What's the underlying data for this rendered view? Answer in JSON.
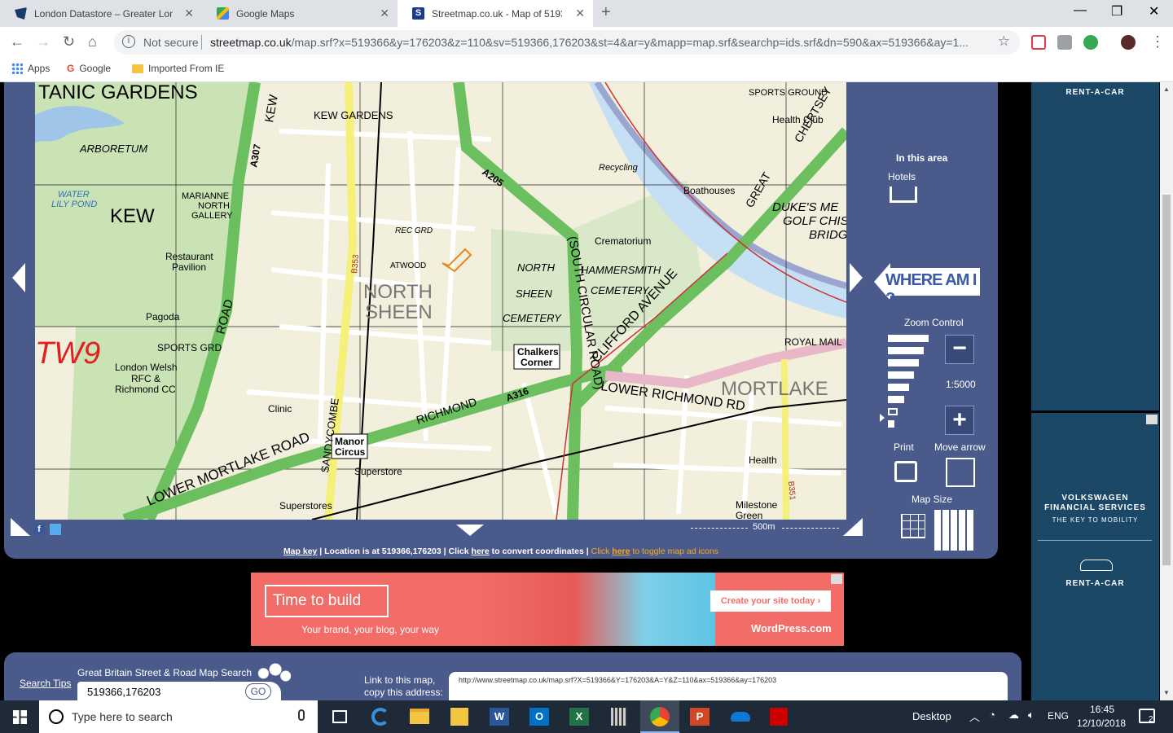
{
  "browser": {
    "tabs": [
      {
        "title": "London Datastore – Greater Lonc",
        "favicon_color": "#1a3a6a"
      },
      {
        "title": "Google Maps",
        "favicon_color": "#34a853"
      },
      {
        "title": "Streetmap.co.uk - Map of 51936",
        "favicon_color": "#1a3a8a",
        "favicon_letter": "S"
      }
    ],
    "not_secure": "Not secure",
    "url_host": "streetmap.co.uk",
    "url_path": "/map.srf?x=519366&y=176203&z=110&sv=519366,176203&st=4&ar=y&mapp=map.srf&searchp=ids.srf&dn=590&ax=519366&ay=1...",
    "bookmarks": [
      "Apps",
      "Google",
      "Imported From IE"
    ]
  },
  "map": {
    "labels": {
      "tanic_gardens": "TANIC GARDENS",
      "kew": "KEW",
      "north_sheen": "NORTH SHEEN",
      "north_sheen_1": "NORTH",
      "north_sheen_2": "SHEEN",
      "mortlake": "MORTLAKE",
      "tw9": "TW9",
      "kew_gardens": "KEW GARDENS",
      "arboretum": "ARBORETUM",
      "crematorium": "Crematorium",
      "hammersmith_cemetery": "HAMMERSMITH",
      "cemetery": "CEMETERY",
      "north_sheen_cemetery_1": "NORTH",
      "north_sheen_cemetery_2": "SHEEN",
      "north_sheen_cemetery_3": "CEMETERY",
      "chalkers_corner_1": "Chalkers",
      "chalkers_corner_2": "Corner",
      "manor_circus_1": "Manor",
      "manor_circus_2": "Circus",
      "superstore": "Superstore",
      "superstores": "Superstores",
      "boathouses": "Boathouses",
      "dukes_meadows": "DUKE'S ME",
      "golf": "GOLF CHIS",
      "bridge": "BRIDG",
      "lower_mortlake_road": "LOWER MORTLAKE ROAD",
      "lower_richmond": "LOWER RICHMOND RD",
      "clifford_avenue": "CLIFFORD AVENUE",
      "south_circular": "(SOUTH CIRCULAR ROAD)",
      "sandycombe": "SANDYCOMBE",
      "a307": "A307",
      "a205": "A205",
      "a316": "A316",
      "b353": "B353",
      "b351": "B351",
      "kew_road": "KEW",
      "road": "ROAD",
      "richmond": "RICHMOND",
      "great": "GREAT",
      "chertsey": "CHERTSEY",
      "sports_grd": "SPORTS GRD",
      "london_welsh": "London Welsh",
      "rfc": "RFC &",
      "richmond_cc": "Richmond CC",
      "restaurant": "Restaurant",
      "pavilion": "Pavilion",
      "pagoda": "Pagoda",
      "marianne_1": "MARIANNE",
      "marianne_2": "NORTH",
      "marianne_3": "GALLERY",
      "water_lily_1": "WATER",
      "water_lily_2": "LILY POND",
      "clinic": "Clinic",
      "milestone_green": "Milestone",
      "green": "Green",
      "royal_mail": "ROYAL MAIL",
      "health_centre": "Health",
      "health_club": "Health Club",
      "sports_ground": "SPORTS GROUND",
      "recycling": "Recycling",
      "rec_grd": "REC GRD",
      "atwood": "ATWOOD",
      "scale": "500m"
    }
  },
  "sidebar": {
    "in_this_area": "In this area",
    "hotels": "Hotels",
    "where_am_i": "WHERE AM I ?",
    "zoom_control": "Zoom Control",
    "scale_ratio": "1:5000",
    "print": "Print",
    "move_arrow": "Move arrow",
    "map_size": "Map Size"
  },
  "footer": {
    "map_key": "Map key",
    "location_text": " | Location is at 519366,176203 | Click ",
    "here1": "here",
    "convert_text": " to convert coordinates | ",
    "click_here": "Click ",
    "here2": "here",
    "toggle_text": " to toggle map ad icons"
  },
  "ad": {
    "headline": "Time to build",
    "tagline": "Your brand, your blog, your way",
    "cta": "Create your site today ›",
    "brand": "WordPress.com"
  },
  "right_ad": {
    "top": "RENT-A-CAR",
    "vw1": "VOLKSWAGEN",
    "vw2": "FINANCIAL SERVICES",
    "vw3": "THE KEY TO MOBILITY",
    "bottom": "RENT-A-CAR"
  },
  "search": {
    "tips": "Search Tips",
    "title": "Great Britain Street & Road Map Search",
    "value": "519366,176203",
    "go": "GO",
    "link_label_1": "Link to this map,",
    "link_label_2": "copy this address:",
    "link_value": "http://www.streetmap.co.uk/map.srf?X=519366&Y=176203&A=Y&Z=110&ax=519366&ay=176203"
  },
  "taskbar": {
    "search_placeholder": "Type here to search",
    "desktop": "Desktop",
    "lang": "ENG",
    "time": "16:45",
    "date": "12/10/2018",
    "notifications": "2"
  }
}
